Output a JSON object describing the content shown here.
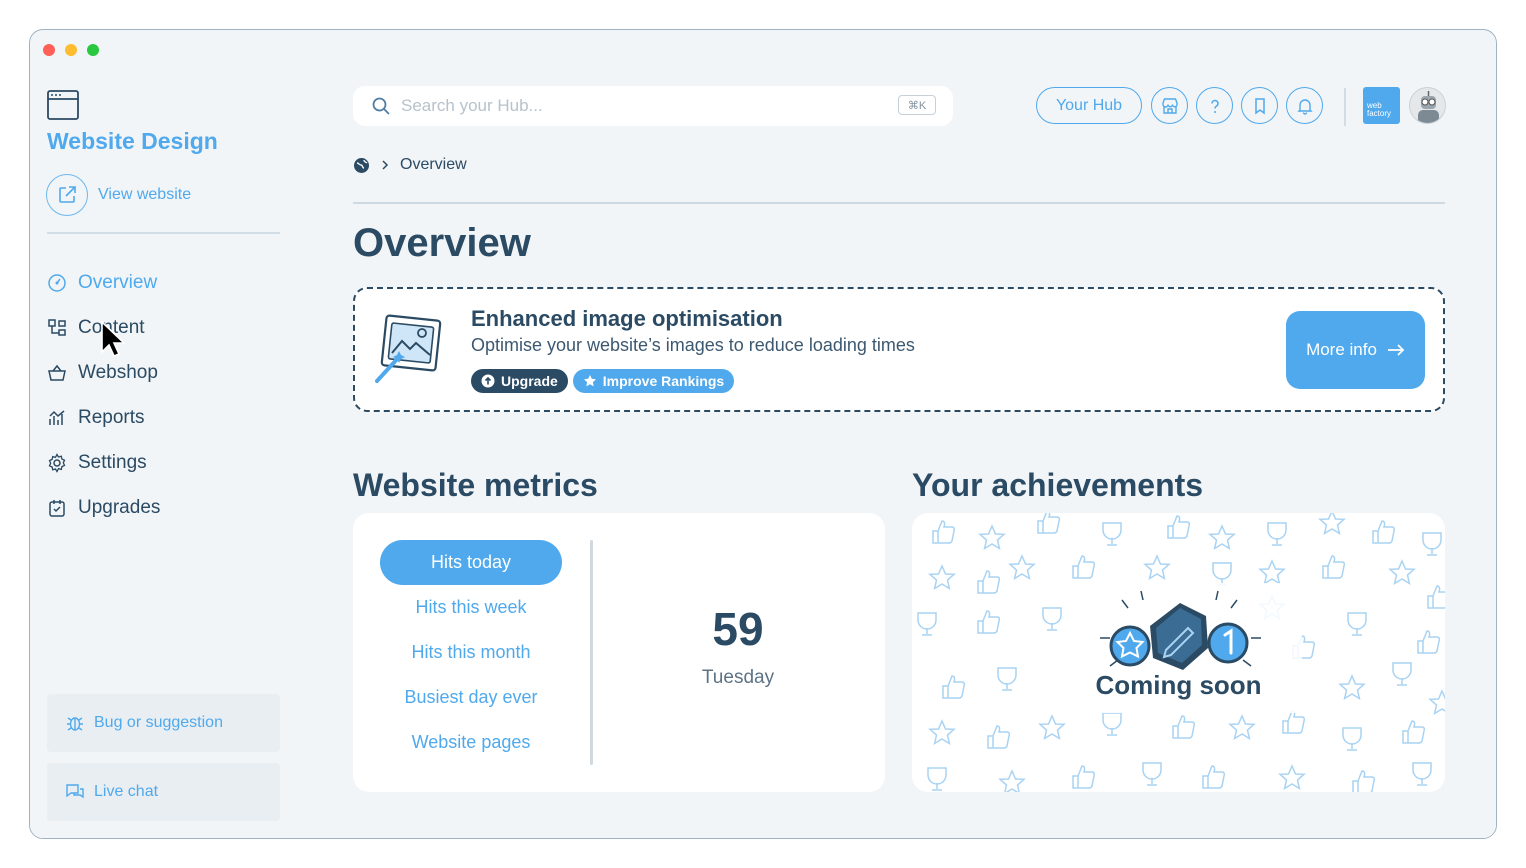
{
  "sidebar": {
    "site_title": "Website Design",
    "view_website": "View website",
    "nav": [
      {
        "label": "Overview",
        "icon": "dashboard-icon",
        "active": true
      },
      {
        "label": "Content",
        "icon": "content-icon",
        "active": false
      },
      {
        "label": "Webshop",
        "icon": "basket-icon",
        "active": false
      },
      {
        "label": "Reports",
        "icon": "chart-icon",
        "active": false
      },
      {
        "label": "Settings",
        "icon": "gear-icon",
        "active": false
      },
      {
        "label": "Upgrades",
        "icon": "upgrade-icon",
        "active": false
      }
    ],
    "bug_label": "Bug or suggestion",
    "chat_label": "Live chat"
  },
  "header": {
    "search_placeholder": "Search your Hub...",
    "search_shortcut": "⌘K",
    "hub_button": "Your Hub",
    "logo_text_1": "web",
    "logo_text_2": "factory"
  },
  "breadcrumb": {
    "current": "Overview"
  },
  "page_title": "Overview",
  "promo": {
    "title": "Enhanced image optimisation",
    "description": "Optimise your website’s images to reduce loading times",
    "tags": [
      "Upgrade",
      "Improve Rankings"
    ],
    "button": "More info"
  },
  "metrics": {
    "title": "Website metrics",
    "tabs": [
      "Hits today",
      "Hits this week",
      "Hits this month",
      "Busiest day ever",
      "Website pages"
    ],
    "active_tab": 0,
    "value": "59",
    "day": "Tuesday"
  },
  "achievements": {
    "title": "Your achievements",
    "status": "Coming soon"
  },
  "colors": {
    "accent": "#4fa9ec",
    "navy": "#2b4a63",
    "background": "#f2f5f7"
  }
}
